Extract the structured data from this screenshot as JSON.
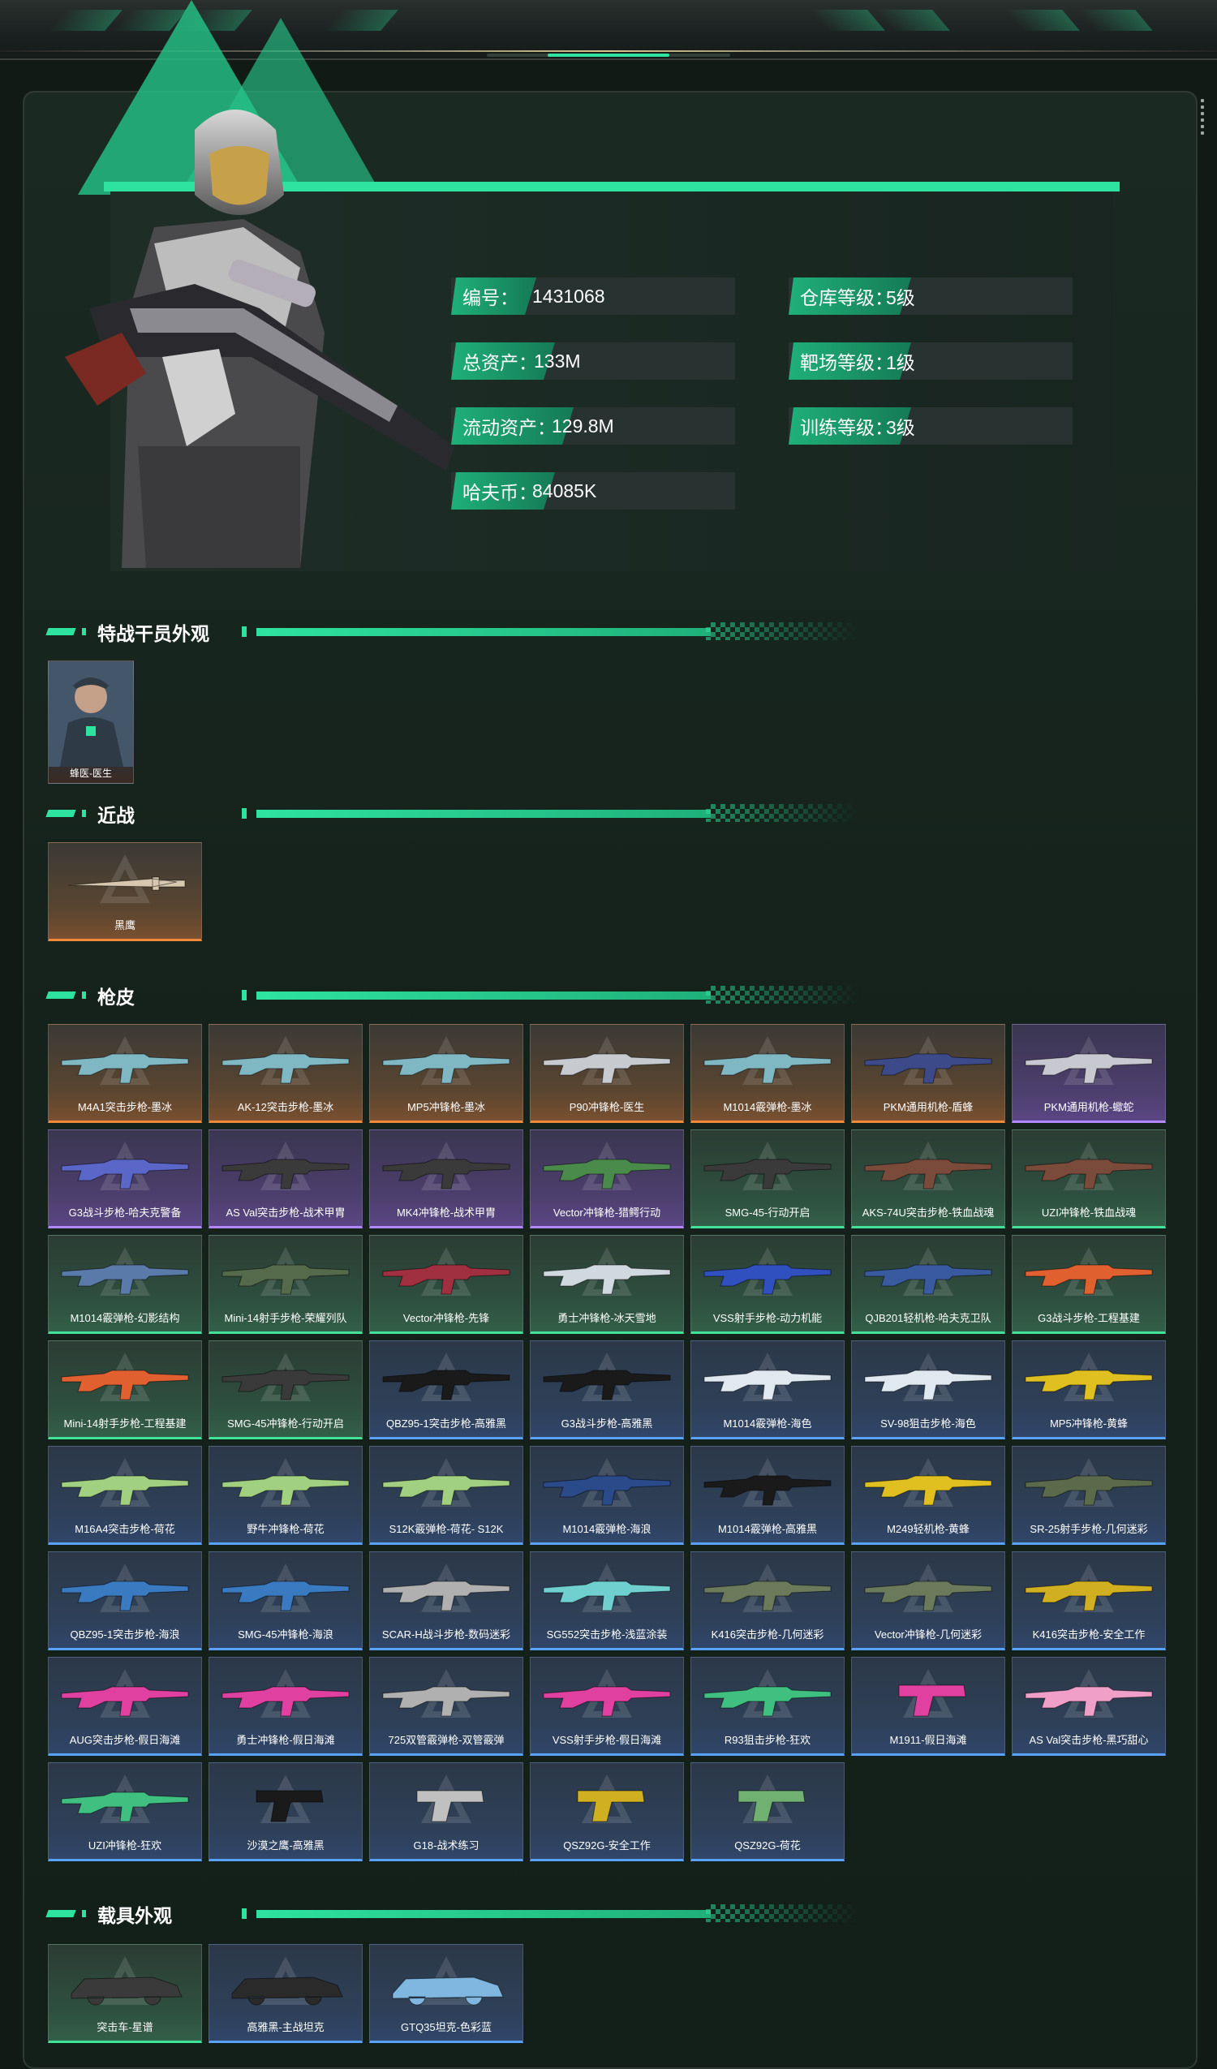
{
  "stats": [
    {
      "label": "编号：",
      "value": "1431068"
    },
    {
      "label": "仓库等级：",
      "value": "5级"
    },
    {
      "label": "总资产：",
      "value": "133M"
    },
    {
      "label": "靶场等级：",
      "value": "1级"
    },
    {
      "label": "流动资产：",
      "value": "129.8M"
    },
    {
      "label": "训练等级：",
      "value": "3级"
    },
    {
      "label": "哈夫币：",
      "value": "84085K"
    }
  ],
  "sections": {
    "operators": "特战干员外观",
    "melee": "近战",
    "skins": "枪皮",
    "vehicles": "载具外观"
  },
  "operator": {
    "label": "蜂医-医生"
  },
  "melee": [
    {
      "label": "黑鹰",
      "quality": "orange"
    }
  ],
  "skins": [
    {
      "label": "M4A1突击步枪-墨冰",
      "quality": "orange",
      "color": "#7fb7c2"
    },
    {
      "label": "AK-12突击步枪-墨冰",
      "quality": "orange",
      "color": "#7fb7c2"
    },
    {
      "label": "MP5冲锋枪-墨冰",
      "quality": "orange",
      "color": "#7fb7c2"
    },
    {
      "label": "P90冲锋枪-医生",
      "quality": "orange",
      "color": "#c7cbd0"
    },
    {
      "label": "M1014霰弹枪-墨冰",
      "quality": "orange",
      "color": "#7fb7c2"
    },
    {
      "label": "PKM通用机枪-盾蜂",
      "quality": "orange",
      "color": "#3d4a8a"
    },
    {
      "label": "PKM通用机枪-蠍蛇",
      "quality": "purple",
      "color": "#c8c8d0"
    },
    {
      "label": "G3战斗步枪-哈夫克警备",
      "quality": "purple",
      "color": "#5a66c8"
    },
    {
      "label": "AS Val突击步枪-战术甲胄",
      "quality": "purple",
      "color": "#3a3a3a"
    },
    {
      "label": "MK4冲锋枪-战术甲胄",
      "quality": "purple",
      "color": "#3a3a3a"
    },
    {
      "label": "Vector冲锋枪-猎鳄行动",
      "quality": "purple",
      "color": "#4a8a4a"
    },
    {
      "label": "SMG-45-行动开启",
      "quality": "green",
      "color": "#3a3a3a"
    },
    {
      "label": "AKS-74U突击步枪-铁血战魂",
      "quality": "green",
      "color": "#7a4a3a"
    },
    {
      "label": "UZI冲锋枪-铁血战魂",
      "quality": "green",
      "color": "#7a4a3a"
    },
    {
      "label": "M1014霰弹枪-幻影结构",
      "quality": "green",
      "color": "#5a7aaa"
    },
    {
      "label": "Mini-14射手步枪-荣耀列队",
      "quality": "green",
      "color": "#556a4a"
    },
    {
      "label": "Vector冲锋枪-先锋",
      "quality": "green",
      "color": "#a03040"
    },
    {
      "label": "勇士冲锋枪-冰天雪地",
      "quality": "green",
      "color": "#d0d8e0"
    },
    {
      "label": "VSS射手步枪-动力机能",
      "quality": "green",
      "color": "#3050c0"
    },
    {
      "label": "QJB201轻机枪-哈夫克卫队",
      "quality": "green",
      "color": "#3a5aa0"
    },
    {
      "label": "G3战斗步枪-工程基建",
      "quality": "green",
      "color": "#e06030"
    },
    {
      "label": "Mini-14射手步枪-工程基建",
      "quality": "green",
      "color": "#e06030"
    },
    {
      "label": "SMG-45冲锋枪-行动开启",
      "quality": "green",
      "color": "#3a3a3a"
    },
    {
      "label": "QBZ95-1突击步枪-高雅黑",
      "quality": "blue",
      "color": "#1a1a1a"
    },
    {
      "label": "G3战斗步枪-高雅黑",
      "quality": "blue",
      "color": "#1a1a1a"
    },
    {
      "label": "M1014霰弹枪-海色",
      "quality": "blue",
      "color": "#e0e8f0"
    },
    {
      "label": "SV-98狙击步枪-海色",
      "quality": "blue",
      "color": "#e0e8f0"
    },
    {
      "label": "MP5冲锋枪-黄蜂",
      "quality": "blue",
      "color": "#e0c020"
    },
    {
      "label": "M16A4突击步枪-荷花",
      "quality": "blue",
      "color": "#a0d080"
    },
    {
      "label": "野牛冲锋枪-荷花",
      "quality": "blue",
      "color": "#a0d080"
    },
    {
      "label": "S12K霰弹枪-荷花- S12K",
      "quality": "blue",
      "color": "#a0d080"
    },
    {
      "label": "M1014霰弹枪-海浪",
      "quality": "blue",
      "color": "#2a4a8a"
    },
    {
      "label": "M1014霰弹枪-高雅黑",
      "quality": "blue",
      "color": "#1a1a1a"
    },
    {
      "label": "M249轻机枪-黄蜂",
      "quality": "blue",
      "color": "#e0c020"
    },
    {
      "label": "SR-25射手步枪-几何迷彩",
      "quality": "blue",
      "color": "#5a6a4a"
    },
    {
      "label": "QBZ95-1突击步枪-海浪",
      "quality": "blue",
      "color": "#3a7ac0"
    },
    {
      "label": "SMG-45冲锋枪-海浪",
      "quality": "blue",
      "color": "#3a7ac0"
    },
    {
      "label": "SCAR-H战斗步枪-数码迷彩",
      "quality": "blue",
      "color": "#b0b0b0"
    },
    {
      "label": "SG552突击步枪-浅蓝涂装",
      "quality": "blue",
      "color": "#70d0d0"
    },
    {
      "label": "K416突击步枪-几何迷彩",
      "quality": "blue",
      "color": "#6a7a5a"
    },
    {
      "label": "Vector冲锋枪-几何迷彩",
      "quality": "blue",
      "color": "#6a7a5a"
    },
    {
      "label": "K416突击步枪-安全工作",
      "quality": "blue",
      "color": "#d0b020"
    },
    {
      "label": "AUG突击步枪-假日海滩",
      "quality": "blue",
      "color": "#e040a0"
    },
    {
      "label": "勇士冲锋枪-假日海滩",
      "quality": "blue",
      "color": "#e040a0"
    },
    {
      "label": "725双管霰弹枪-双管霰弹",
      "quality": "blue",
      "color": "#b0b0b0"
    },
    {
      "label": "VSS射手步枪-假日海滩",
      "quality": "blue",
      "color": "#e040a0"
    },
    {
      "label": "R93狙击步枪-狂欢",
      "quality": "blue",
      "color": "#40c080"
    },
    {
      "label": "M1911-假日海滩",
      "quality": "blue",
      "color": "#e040a0"
    },
    {
      "label": "AS Val突击步枪-黑巧甜心",
      "quality": "blue",
      "color": "#f0a0c8"
    },
    {
      "label": "UZI冲锋枪-狂欢",
      "quality": "blue",
      "color": "#40c080"
    },
    {
      "label": "沙漠之鹰-高雅黑",
      "quality": "blue",
      "color": "#1a1a1a"
    },
    {
      "label": "G18-战术练习",
      "quality": "blue",
      "color": "#c0c0c0"
    },
    {
      "label": "QSZ92G-安全工作",
      "quality": "blue",
      "color": "#d0b020"
    },
    {
      "label": "QSZ92G-荷花",
      "quality": "blue",
      "color": "#70b070"
    }
  ],
  "vehicles": [
    {
      "label": "突击车-星谱",
      "quality": "green"
    },
    {
      "label": "高雅黑-主战坦克",
      "quality": "blue"
    },
    {
      "label": "GTQ35坦克-色彩蓝",
      "quality": "blue"
    }
  ]
}
